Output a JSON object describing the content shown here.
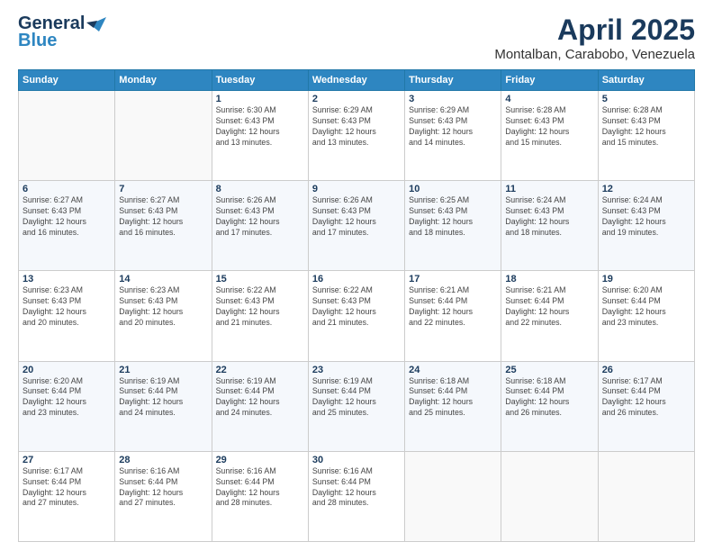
{
  "logo": {
    "line1": "General",
    "line2": "Blue"
  },
  "title": "April 2025",
  "subtitle": "Montalban, Carabobo, Venezuela",
  "weekdays": [
    "Sunday",
    "Monday",
    "Tuesday",
    "Wednesday",
    "Thursday",
    "Friday",
    "Saturday"
  ],
  "rows": [
    [
      {
        "day": "",
        "info": ""
      },
      {
        "day": "",
        "info": ""
      },
      {
        "day": "1",
        "info": "Sunrise: 6:30 AM\nSunset: 6:43 PM\nDaylight: 12 hours\nand 13 minutes."
      },
      {
        "day": "2",
        "info": "Sunrise: 6:29 AM\nSunset: 6:43 PM\nDaylight: 12 hours\nand 13 minutes."
      },
      {
        "day": "3",
        "info": "Sunrise: 6:29 AM\nSunset: 6:43 PM\nDaylight: 12 hours\nand 14 minutes."
      },
      {
        "day": "4",
        "info": "Sunrise: 6:28 AM\nSunset: 6:43 PM\nDaylight: 12 hours\nand 15 minutes."
      },
      {
        "day": "5",
        "info": "Sunrise: 6:28 AM\nSunset: 6:43 PM\nDaylight: 12 hours\nand 15 minutes."
      }
    ],
    [
      {
        "day": "6",
        "info": "Sunrise: 6:27 AM\nSunset: 6:43 PM\nDaylight: 12 hours\nand 16 minutes."
      },
      {
        "day": "7",
        "info": "Sunrise: 6:27 AM\nSunset: 6:43 PM\nDaylight: 12 hours\nand 16 minutes."
      },
      {
        "day": "8",
        "info": "Sunrise: 6:26 AM\nSunset: 6:43 PM\nDaylight: 12 hours\nand 17 minutes."
      },
      {
        "day": "9",
        "info": "Sunrise: 6:26 AM\nSunset: 6:43 PM\nDaylight: 12 hours\nand 17 minutes."
      },
      {
        "day": "10",
        "info": "Sunrise: 6:25 AM\nSunset: 6:43 PM\nDaylight: 12 hours\nand 18 minutes."
      },
      {
        "day": "11",
        "info": "Sunrise: 6:24 AM\nSunset: 6:43 PM\nDaylight: 12 hours\nand 18 minutes."
      },
      {
        "day": "12",
        "info": "Sunrise: 6:24 AM\nSunset: 6:43 PM\nDaylight: 12 hours\nand 19 minutes."
      }
    ],
    [
      {
        "day": "13",
        "info": "Sunrise: 6:23 AM\nSunset: 6:43 PM\nDaylight: 12 hours\nand 20 minutes."
      },
      {
        "day": "14",
        "info": "Sunrise: 6:23 AM\nSunset: 6:43 PM\nDaylight: 12 hours\nand 20 minutes."
      },
      {
        "day": "15",
        "info": "Sunrise: 6:22 AM\nSunset: 6:43 PM\nDaylight: 12 hours\nand 21 minutes."
      },
      {
        "day": "16",
        "info": "Sunrise: 6:22 AM\nSunset: 6:43 PM\nDaylight: 12 hours\nand 21 minutes."
      },
      {
        "day": "17",
        "info": "Sunrise: 6:21 AM\nSunset: 6:44 PM\nDaylight: 12 hours\nand 22 minutes."
      },
      {
        "day": "18",
        "info": "Sunrise: 6:21 AM\nSunset: 6:44 PM\nDaylight: 12 hours\nand 22 minutes."
      },
      {
        "day": "19",
        "info": "Sunrise: 6:20 AM\nSunset: 6:44 PM\nDaylight: 12 hours\nand 23 minutes."
      }
    ],
    [
      {
        "day": "20",
        "info": "Sunrise: 6:20 AM\nSunset: 6:44 PM\nDaylight: 12 hours\nand 23 minutes."
      },
      {
        "day": "21",
        "info": "Sunrise: 6:19 AM\nSunset: 6:44 PM\nDaylight: 12 hours\nand 24 minutes."
      },
      {
        "day": "22",
        "info": "Sunrise: 6:19 AM\nSunset: 6:44 PM\nDaylight: 12 hours\nand 24 minutes."
      },
      {
        "day": "23",
        "info": "Sunrise: 6:19 AM\nSunset: 6:44 PM\nDaylight: 12 hours\nand 25 minutes."
      },
      {
        "day": "24",
        "info": "Sunrise: 6:18 AM\nSunset: 6:44 PM\nDaylight: 12 hours\nand 25 minutes."
      },
      {
        "day": "25",
        "info": "Sunrise: 6:18 AM\nSunset: 6:44 PM\nDaylight: 12 hours\nand 26 minutes."
      },
      {
        "day": "26",
        "info": "Sunrise: 6:17 AM\nSunset: 6:44 PM\nDaylight: 12 hours\nand 26 minutes."
      }
    ],
    [
      {
        "day": "27",
        "info": "Sunrise: 6:17 AM\nSunset: 6:44 PM\nDaylight: 12 hours\nand 27 minutes."
      },
      {
        "day": "28",
        "info": "Sunrise: 6:16 AM\nSunset: 6:44 PM\nDaylight: 12 hours\nand 27 minutes."
      },
      {
        "day": "29",
        "info": "Sunrise: 6:16 AM\nSunset: 6:44 PM\nDaylight: 12 hours\nand 28 minutes."
      },
      {
        "day": "30",
        "info": "Sunrise: 6:16 AM\nSunset: 6:44 PM\nDaylight: 12 hours\nand 28 minutes."
      },
      {
        "day": "",
        "info": ""
      },
      {
        "day": "",
        "info": ""
      },
      {
        "day": "",
        "info": ""
      }
    ]
  ]
}
